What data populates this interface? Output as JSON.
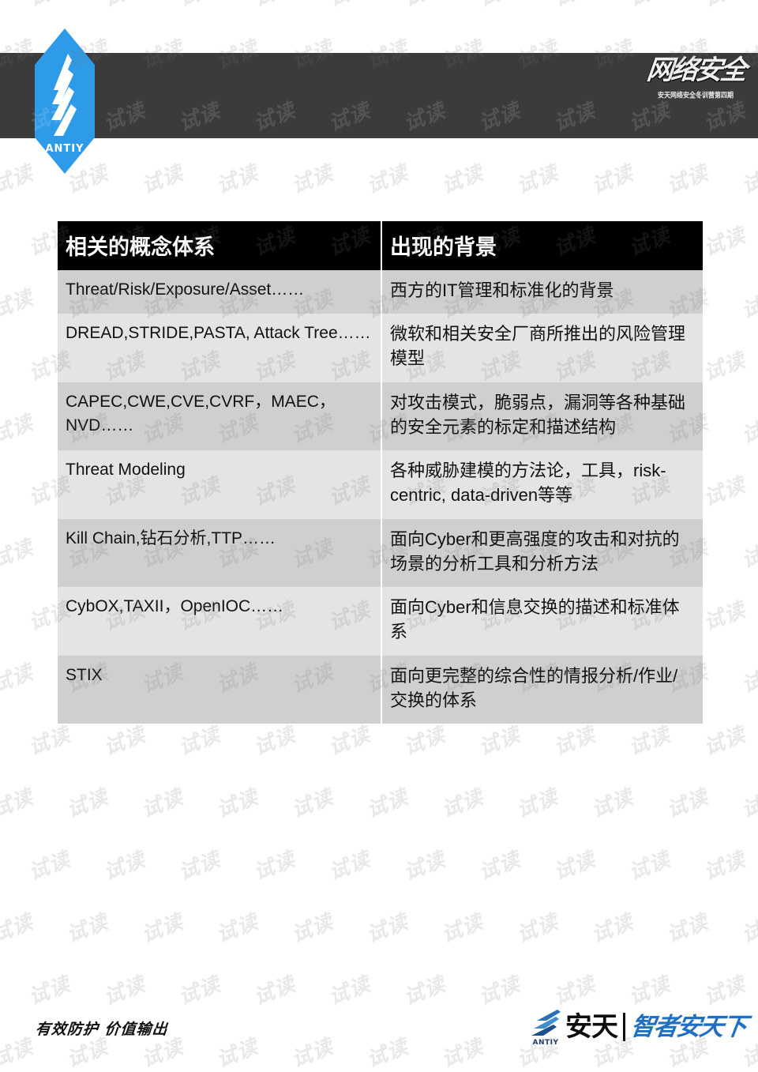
{
  "brand": {
    "badge_icon": "antiy-wing-badge-icon",
    "badge_label": "ANTIY",
    "badge_color": "#2e9be8",
    "header_band_color": "#3b3b3b"
  },
  "course_logo": {
    "script_text": "网络安全",
    "subtitle": "安天网络安全冬训营第四期"
  },
  "table": {
    "headers": [
      "相关的概念体系",
      "出现的背景"
    ],
    "header_bg": "#000000",
    "header_fg": "#ffffff",
    "row_shade_a": "#cfcfcf",
    "row_shade_b": "#e4e4e4",
    "rows": [
      {
        "concept": "Threat/Risk/Exposure/Asset……",
        "background": "西方的IT管理和标准化的背景"
      },
      {
        "concept": "DREAD,STRIDE,PASTA, Attack Tree……",
        "background": "微软和相关安全厂商所推出的风险管理模型"
      },
      {
        "concept": "CAPEC,CWE,CVE,CVRF，MAEC，NVD……",
        "background": "对攻击模式，脆弱点，漏洞等各种基础的安全元素的标定和描述结构"
      },
      {
        "concept": "Threat Modeling",
        "background": "各种威胁建模的方法论，工具，risk-centric, data-driven等等"
      },
      {
        "concept": "Kill Chain,钻石分析,TTP……",
        "background": "面向Cyber和更高强度的攻击和对抗的场景的分析工具和分析方法"
      },
      {
        "concept": "CybOX,TAXII，OpenIOC……",
        "background": "面向Cyber和信息交换的描述和标准体系"
      },
      {
        "concept": "STIX",
        "background": "面向更完整的综合性的情报分析/作业/交换的体系"
      }
    ]
  },
  "footer": {
    "tagline": "有效防护 价值输出",
    "logo_word": "ANTIY",
    "logo_cn": "安天",
    "slogan": "智者安天下"
  },
  "watermark": {
    "text": "试读"
  }
}
